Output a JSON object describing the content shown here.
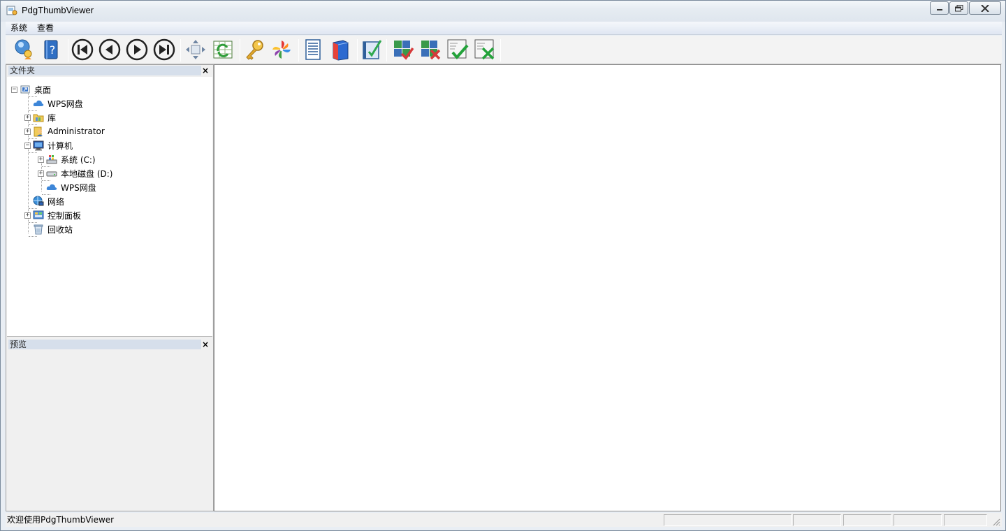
{
  "window": {
    "title": "PdgThumbViewer"
  },
  "menu": {
    "items": [
      "系统",
      "查看"
    ]
  },
  "toolbar": {
    "buttons": [
      {
        "icon": "search-user-icon"
      },
      {
        "icon": "help-book-icon"
      },
      {
        "icon": "first-page-icon"
      },
      {
        "icon": "prev-page-icon"
      },
      {
        "icon": "next-page-icon"
      },
      {
        "icon": "last-page-icon"
      },
      {
        "icon": "fit-arrows-icon"
      },
      {
        "icon": "refresh-grid-icon"
      },
      {
        "icon": "key-icon"
      },
      {
        "icon": "pinwheel-icon"
      },
      {
        "icon": "document-list-icon"
      },
      {
        "icon": "book-icon"
      },
      {
        "icon": "checklist-icon"
      },
      {
        "icon": "puzzle-check-icon"
      },
      {
        "icon": "puzzle-cross-icon"
      },
      {
        "icon": "doc-check-icon"
      },
      {
        "icon": "doc-cross-icon"
      }
    ]
  },
  "folder_panel": {
    "title": "文件夹",
    "close": "×",
    "tree": [
      {
        "label": "桌面",
        "icon": "desktop-icon",
        "expander": "⊟"
      },
      {
        "label": "WPS网盘",
        "icon": "cloud-icon",
        "expander": ""
      },
      {
        "label": "库",
        "icon": "library-icon",
        "expander": "⊞"
      },
      {
        "label": "Administrator",
        "icon": "user-folder-icon",
        "expander": "⊞"
      },
      {
        "label": "计算机",
        "icon": "computer-icon",
        "expander": "⊟"
      },
      {
        "label": "系统 (C:)",
        "icon": "system-drive-icon",
        "expander": "⊞"
      },
      {
        "label": "本地磁盘 (D:)",
        "icon": "disk-drive-icon",
        "expander": "⊞"
      },
      {
        "label": "WPS网盘",
        "icon": "cloud-icon",
        "expander": ""
      },
      {
        "label": "网络",
        "icon": "network-icon",
        "expander": ""
      },
      {
        "label": "控制面板",
        "icon": "control-panel-icon",
        "expander": "⊞"
      },
      {
        "label": "回收站",
        "icon": "recycle-bin-icon",
        "expander": ""
      }
    ]
  },
  "preview_panel": {
    "title": "预览",
    "close": "×"
  },
  "status": {
    "text": "欢迎使用PdgThumbViewer"
  },
  "colors": {
    "panel_header": "#d6dfeb",
    "toolbar_bg": "#f3f3f3",
    "menubar_bg": "#e4eaf4"
  }
}
